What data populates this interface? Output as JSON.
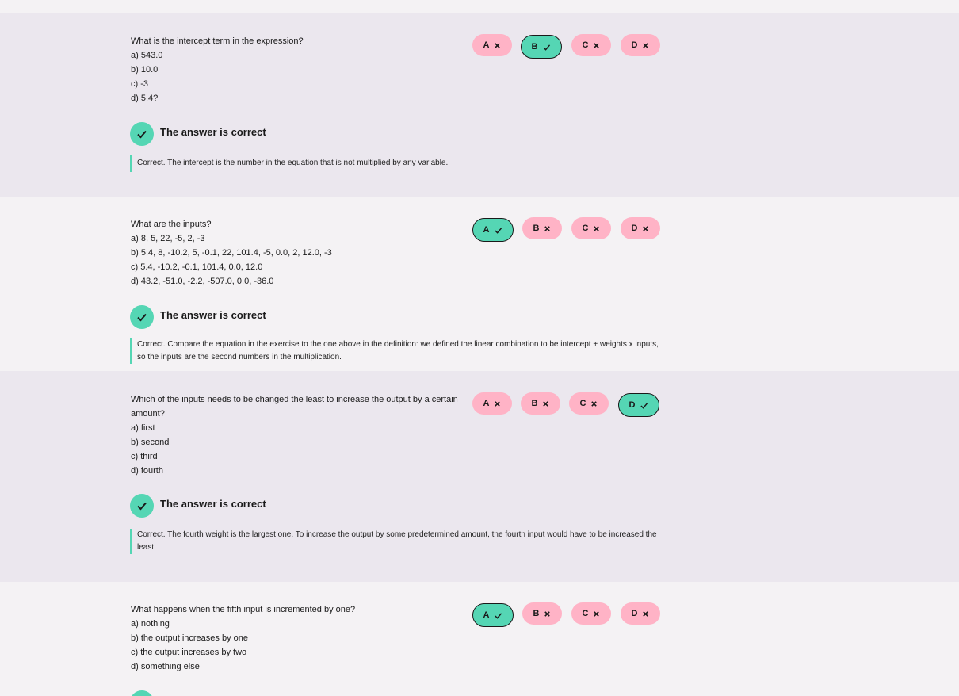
{
  "colors": {
    "correct_accent": "#55d6b4",
    "wrong_chip": "#ffb3c6",
    "band_dark": "#ebe7ee",
    "band_light": "#f4f2f4"
  },
  "questions": [
    {
      "text": "What is the intercept term in the expression?",
      "options": [
        "a) 543.0",
        "b) 10.0",
        "c) -3",
        "d) 5.4?"
      ],
      "choices": [
        {
          "label": "A",
          "status": "wrong",
          "icon": "x-icon"
        },
        {
          "label": "B",
          "status": "correct",
          "icon": "check-icon"
        },
        {
          "label": "C",
          "status": "wrong",
          "icon": "x-icon"
        },
        {
          "label": "D",
          "status": "wrong",
          "icon": "x-icon"
        }
      ],
      "result": "The answer is correct",
      "explanation": "Correct. The intercept is the number in the equation that is not multiplied by any variable."
    },
    {
      "text": "What are the inputs?",
      "options": [
        "a) 8, 5, 22, -5, 2, -3",
        "b) 5.4, 8, -10.2, 5, -0.1, 22, 101.4, -5, 0.0, 2, 12.0, -3",
        "c) 5.4, -10.2, -0.1, 101.4, 0.0, 12.0",
        "d) 43.2, -51.0, -2.2, -507.0, 0.0, -36.0"
      ],
      "choices": [
        {
          "label": "A",
          "status": "correct",
          "icon": "check-icon"
        },
        {
          "label": "B",
          "status": "wrong",
          "icon": "x-icon"
        },
        {
          "label": "C",
          "status": "wrong",
          "icon": "x-icon"
        },
        {
          "label": "D",
          "status": "wrong",
          "icon": "x-icon"
        }
      ],
      "result": "The answer is correct",
      "explanation": "Correct. Compare the equation in the exercise to the one above in the definition: we defined the linear combination to be intercept + weights x inputs, so the inputs are the second numbers in the multiplication."
    },
    {
      "text": "Which of the inputs needs to be changed the least to increase the output by a certain amount?",
      "options": [
        "a) first",
        "b) second",
        "c) third",
        "d) fourth"
      ],
      "choices": [
        {
          "label": "A",
          "status": "wrong",
          "icon": "x-icon"
        },
        {
          "label": "B",
          "status": "wrong",
          "icon": "x-icon"
        },
        {
          "label": "C",
          "status": "wrong",
          "icon": "x-icon"
        },
        {
          "label": "D",
          "status": "correct",
          "icon": "check-icon"
        }
      ],
      "result": "The answer is correct",
      "explanation": "Correct. The fourth weight is the largest one. To increase the output by some predetermined amount, the fourth input would have to be increased the least."
    },
    {
      "text": "What happens when the fifth input is incremented by one?",
      "options": [
        "a) nothing",
        "b) the output increases by one",
        "c) the output increases by two",
        "d) something else"
      ],
      "choices": [
        {
          "label": "A",
          "status": "correct",
          "icon": "check-icon"
        },
        {
          "label": "B",
          "status": "wrong",
          "icon": "x-icon"
        },
        {
          "label": "C",
          "status": "wrong",
          "icon": "x-icon"
        },
        {
          "label": "D",
          "status": "wrong",
          "icon": "x-icon"
        }
      ]
    }
  ]
}
